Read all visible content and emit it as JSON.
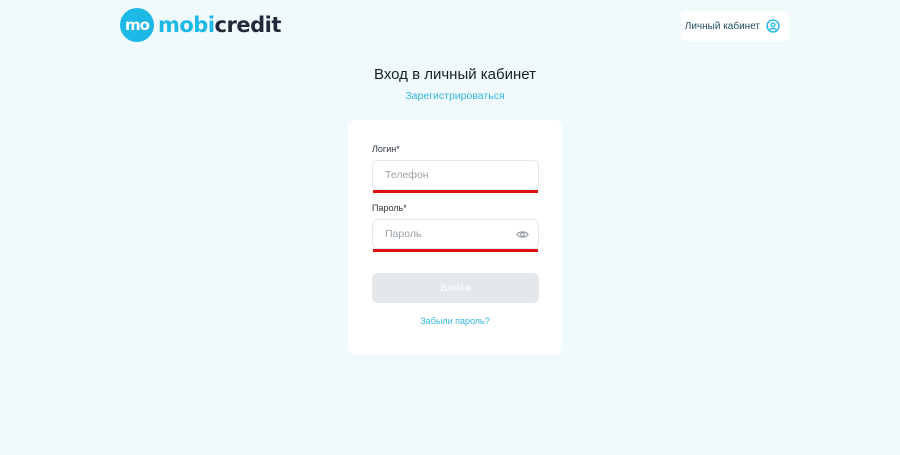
{
  "brand": {
    "mark": "mo",
    "name_part1": "mobi",
    "name_part2": "credit",
    "accent_color": "#1cb9e6"
  },
  "header": {
    "cabinet_label": "Личный кабинет",
    "cabinet_icon": "user-circle-icon"
  },
  "page": {
    "title": "Вход в личный кабинет",
    "register_link": "Зарегистрироваться"
  },
  "form": {
    "login_label": "Логин*",
    "login_placeholder": "Телефон",
    "login_value": "",
    "password_label": "Пароль*",
    "password_placeholder": "Пароль",
    "password_value": "",
    "password_toggle_icon": "eye-icon",
    "submit_label": "Войти",
    "forgot_link": "Забыли пароль?",
    "error_underline_color": "#dd1111"
  }
}
